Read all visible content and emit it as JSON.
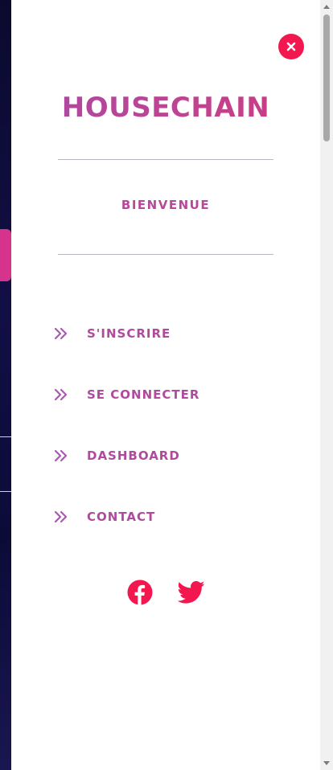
{
  "brand": {
    "logo_text": "HOUSECHAIN",
    "welcome_text": "BIENVENUE"
  },
  "menu": {
    "items": [
      {
        "label": "S'INSCRIRE",
        "icon": "double-chevron-right-icon"
      },
      {
        "label": "SE CONNECTER",
        "icon": "double-chevron-right-icon"
      },
      {
        "label": "DASHBOARD",
        "icon": "double-chevron-right-icon"
      },
      {
        "label": "CONTACT",
        "icon": "double-chevron-right-icon"
      }
    ]
  },
  "social": {
    "items": [
      {
        "icon": "facebook-icon"
      },
      {
        "icon": "twitter-icon"
      }
    ]
  },
  "colors": {
    "accent": "#f2184f",
    "brand_pink": "#b04a9e",
    "divider": "#b9b6c2",
    "backdrop": "#120f45"
  },
  "controls": {
    "close_icon": "close-icon"
  }
}
